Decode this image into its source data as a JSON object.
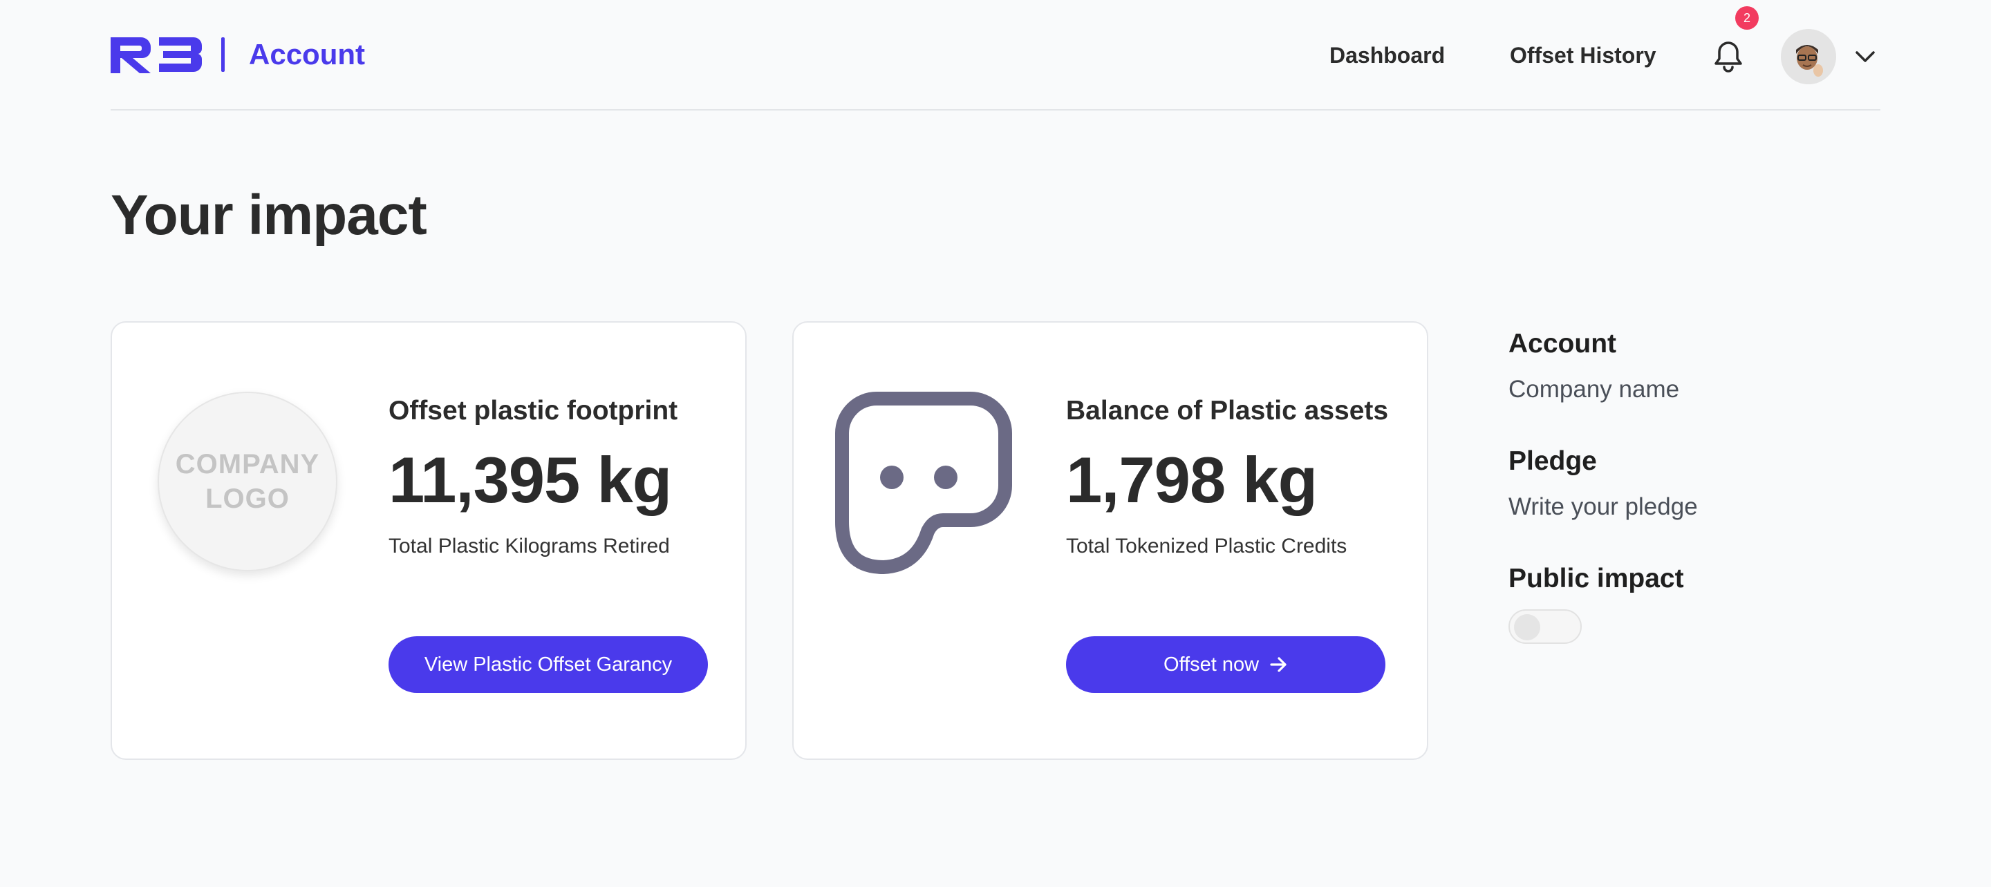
{
  "header": {
    "brand_title": "Account",
    "nav": {
      "dashboard": "Dashboard",
      "offset_history": "Offset History"
    },
    "notifications_count": "2",
    "icons": [
      "r3-logo",
      "bell-icon",
      "avatar",
      "chevron-down-icon"
    ]
  },
  "main": {
    "title": "Your impact",
    "cards": [
      {
        "logo_text_1": "COMPANY",
        "logo_text_2": "LOGO",
        "heading": "Offset plastic footprint",
        "value": "11,395 kg",
        "subtitle": "Total Plastic Kilograms Retired",
        "button_label": "View Plastic Offset Garancy"
      },
      {
        "icon": "plastic-mascot-icon",
        "heading": "Balance of Plastic assets",
        "value": "1,798 kg",
        "subtitle": "Total Tokenized Plastic Credits",
        "button_label": "Offset now"
      }
    ]
  },
  "side": {
    "account_label": "Account",
    "account_value": "Company name",
    "pledge_label": "Pledge",
    "pledge_value": "Write your pledge",
    "public_impact_label": "Public impact",
    "public_impact_enabled": false
  },
  "colors": {
    "accent": "#4a3aeb",
    "badge": "#f23b5f",
    "background": "#f9fafb",
    "mascot": "#6b6a85"
  }
}
